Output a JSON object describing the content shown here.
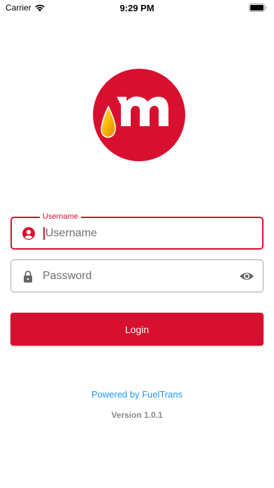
{
  "status_bar": {
    "carrier": "Carrier",
    "time": "9:29 PM",
    "icons": [
      "wifi-icon",
      "battery-icon"
    ]
  },
  "logo": {
    "description_icon": "brand-logo",
    "brand_color": "#d8102f",
    "drop_color": "#f5b400"
  },
  "login_form": {
    "username": {
      "label": "Username",
      "placeholder": "Username",
      "value": "",
      "icon": "user-circle-icon",
      "focused": true
    },
    "password": {
      "placeholder": "Password",
      "value": "",
      "icon": "lock-icon",
      "toggle_icon": "eye-icon"
    },
    "login_label": "Login"
  },
  "footer": {
    "powered_by": "Powered by FuelTrans",
    "version": "Version 1.0.1"
  },
  "colors": {
    "accent": "#d8102f",
    "link": "#2196f3",
    "muted": "#8a8a8a"
  }
}
